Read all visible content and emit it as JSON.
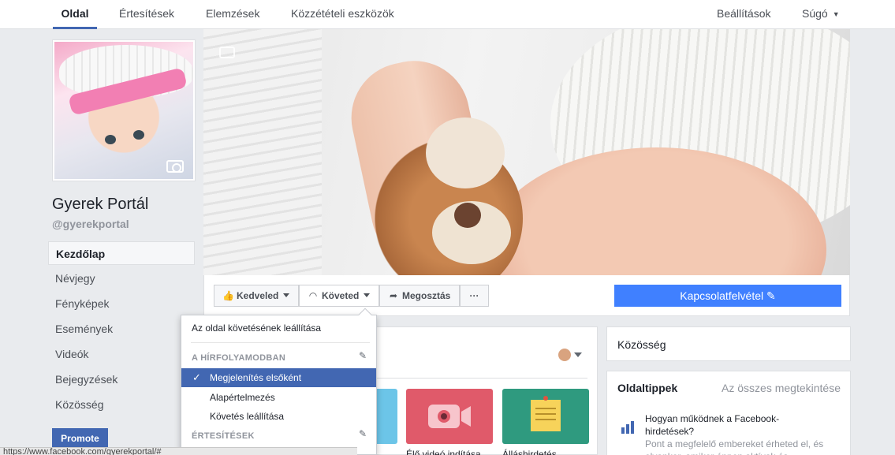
{
  "topnav": {
    "tabs": [
      {
        "label": "Oldal",
        "active": true
      },
      {
        "label": "Értesítések"
      },
      {
        "label": "Elemzések"
      },
      {
        "label": "Közzétételi eszközök"
      }
    ],
    "settings": "Beállítások",
    "help": "Súgó"
  },
  "page": {
    "name": "Gyerek Portál",
    "handle": "@gyerekportal"
  },
  "leftnav": [
    {
      "label": "Kezdőlap",
      "active": true
    },
    {
      "label": "Névjegy"
    },
    {
      "label": "Fényképek"
    },
    {
      "label": "Események"
    },
    {
      "label": "Videók"
    },
    {
      "label": "Bejegyzések"
    },
    {
      "label": "Közösség"
    }
  ],
  "promote": "Promote",
  "actions": {
    "like": "Kedveled",
    "follow": "Követed",
    "share": "Megosztás",
    "more": "···",
    "contact": "Kapcsolatfelvétel"
  },
  "dropdown": {
    "unfollow_page": "Az oldal követésének leállítása",
    "section_feed": "A HÍRFOLYAMODBAN",
    "see_first": "Megjelenítés elsőként",
    "default": "Alapértelmezés",
    "unfollow": "Követés leállítása",
    "section_notifications": "ÉRTESÍTÉSEK"
  },
  "tiles": {
    "live_video": "Élő videó indítása",
    "job_post": "Álláshirdetés"
  },
  "right": {
    "community": "Közösség",
    "tips_title": "Oldaltippek",
    "see_all": "Az összes megtekintése",
    "tip_heading": "Hogyan működnek a Facebook-hirdetések?",
    "tip_body": "Pont a megfelelő embereket érheted el, és olyankor, amikor éppen aktívak és"
  },
  "status_url": "https://www.facebook.com/gyerekportal/#",
  "colors": {
    "brand": "#4267b2",
    "contact": "#4080ff",
    "tile_live": "#e05a6a",
    "tile_job": "#2f9a7f",
    "tile_blue": "#6cc5e8"
  }
}
